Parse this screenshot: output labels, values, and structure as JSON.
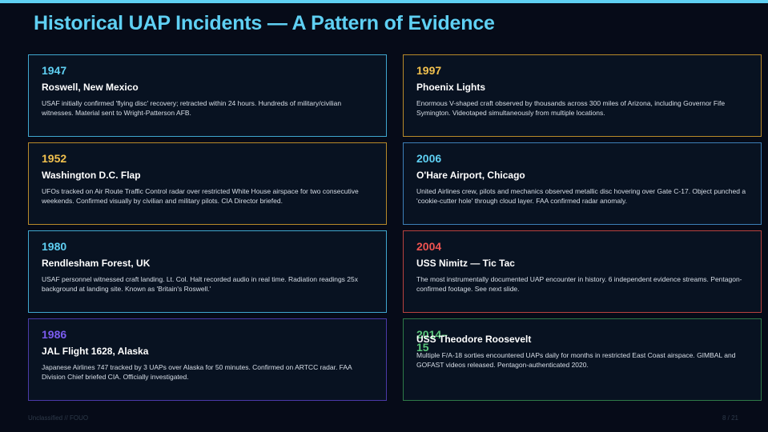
{
  "title": "Historical UAP Incidents — A Pattern of Evidence",
  "incidents": [
    {
      "year": "1947",
      "place": "Roswell, New Mexico",
      "desc": "USAF initially confirmed 'flying disc' recovery; retracted within 24 hours. Hundreds of military/civilian witnesses. Material sent to Wright-Patterson AFB."
    },
    {
      "year": "1997",
      "place": "Phoenix Lights",
      "desc": "Enormous V-shaped craft observed by thousands across 300 miles of Arizona, including Governor Fife Symington. Videotaped simultaneously from multiple locations."
    },
    {
      "year": "1952",
      "place": "Washington D.C. Flap",
      "desc": "UFOs tracked on Air Route Traffic Control radar over restricted White House airspace for two consecutive weekends. Confirmed visually by civilian and military pilots. CIA Director briefed."
    },
    {
      "year": "2006",
      "place": "O'Hare Airport, Chicago",
      "desc": "United Airlines crew, pilots and mechanics observed metallic disc hovering over Gate C-17. Object punched a 'cookie-cutter hole' through cloud layer. FAA confirmed radar anomaly."
    },
    {
      "year": "1980",
      "place": "Rendlesham Forest, UK",
      "desc": "USAF personnel witnessed craft landing. Lt. Col. Halt recorded audio in real time. Radiation readings 25x background at landing site. Known as 'Britain's Roswell.'"
    },
    {
      "year": "2004",
      "place": "USS Nimitz — Tic Tac",
      "desc": "The most instrumentally documented UAP encounter in history. 6 independent evidence streams. Pentagon-confirmed footage. See next slide."
    },
    {
      "year": "1986",
      "place": "JAL Flight 1628, Alaska",
      "desc": "Japanese Airlines 747 tracked by 3 UAPs over Alaska for 50 minutes. Confirmed on ARTCC radar. FAA Division Chief briefed CIA. Officially investigated."
    },
    {
      "year": "2014–15",
      "place": "USS Theodore Roosevelt",
      "desc": "Multiple F/A-18 sorties encountered UAPs daily for months in restricted East Coast airspace. GIMBAL and GOFAST videos released. Pentagon-authenticated 2020."
    }
  ],
  "footer": {
    "classification": "Unclassified // FOUO",
    "page": "8 / 21"
  },
  "colors": {
    "accent": "#5fd0f3",
    "gold": "#f2c14e",
    "red": "#ef5350",
    "violet": "#7b5cf0",
    "green": "#5ac77a",
    "background": "#060b18"
  }
}
